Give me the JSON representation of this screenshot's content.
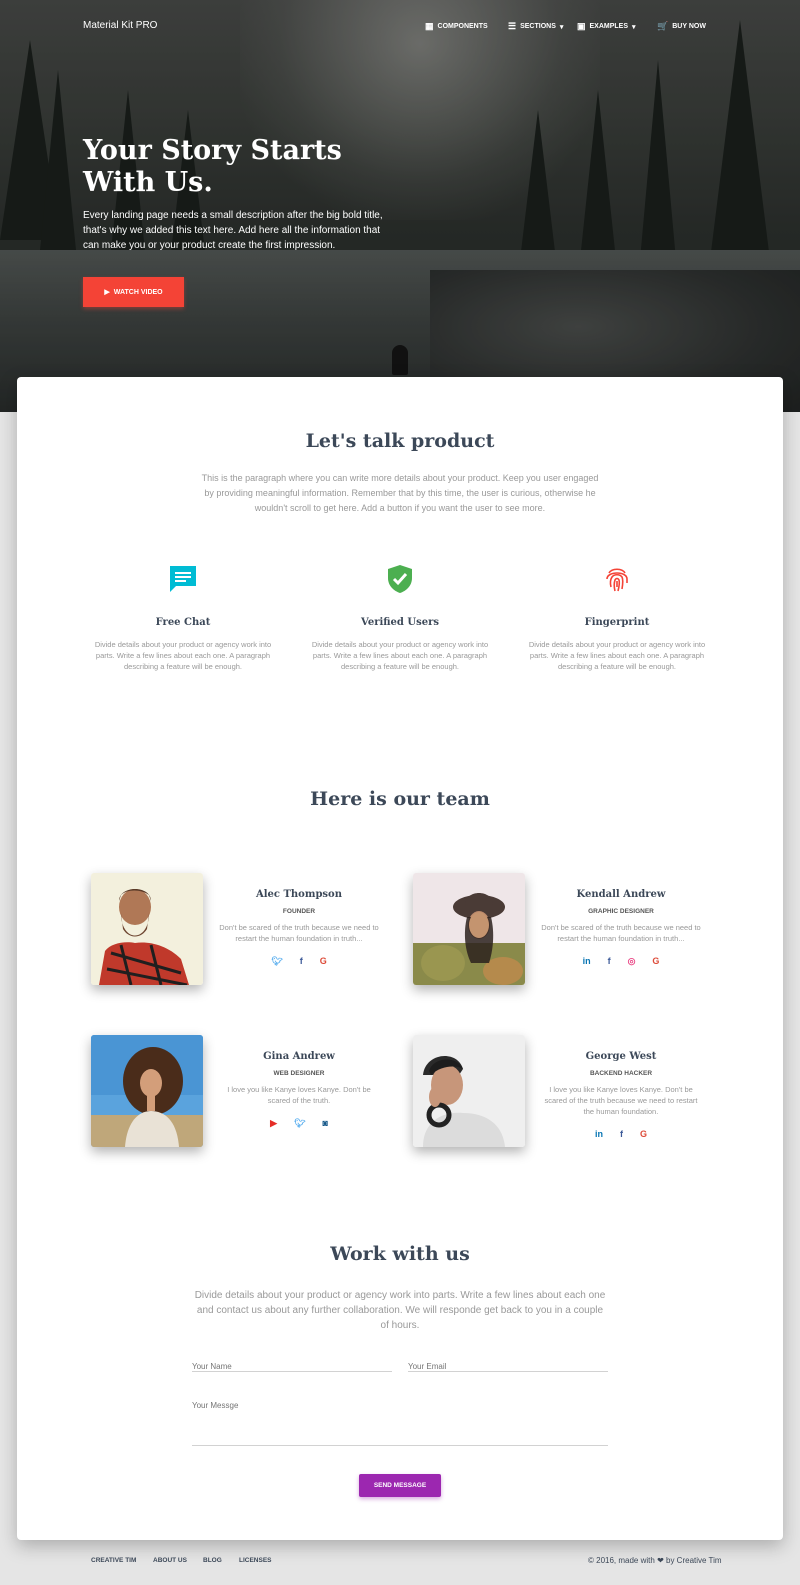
{
  "nav": {
    "brand": "Material Kit PRO",
    "items": [
      {
        "label": "Components",
        "icon": "grid-icon"
      },
      {
        "label": "Sections",
        "icon": "view-day-icon"
      },
      {
        "label": "Examples",
        "icon": "camera-icon"
      },
      {
        "label": "Buy Now",
        "icon": "cart-icon"
      }
    ]
  },
  "hero": {
    "title": "Your Story Starts With Us.",
    "description": "Every landing page needs a small description after the big bold title, that's why we added this text here. Add here all the information that can make you or your product create the first impression.",
    "button": "Watch video"
  },
  "product": {
    "title": "Let's talk product",
    "description": "This is the paragraph where you can write more details about your product. Keep you user engaged by providing meaningful information. Remember that by this time, the user is curious, otherwise he wouldn't scroll to get here. Add a button if you want the user to see more.",
    "features": [
      {
        "title": "Free Chat",
        "icon": "chat-icon",
        "color": "#00bcd4",
        "text": "Divide details about your product or agency work into parts. Write a few lines about each one. A paragraph describing a feature will be enough."
      },
      {
        "title": "Verified Users",
        "icon": "verified-shield-icon",
        "color": "#4caf50",
        "text": "Divide details about your product or agency work into parts. Write a few lines about each one. A paragraph describing a feature will be enough."
      },
      {
        "title": "Fingerprint",
        "icon": "fingerprint-icon",
        "color": "#f44336",
        "text": "Divide details about your product or agency work into parts. Write a few lines about each one. A paragraph describing a feature will be enough."
      }
    ]
  },
  "team": {
    "title": "Here is our team",
    "members": [
      {
        "name": "Alec Thompson",
        "role": "Founder",
        "bio": "Don't be scared of the truth because we need to restart the human foundation in truth...",
        "socials": [
          "twitter",
          "facebook",
          "google"
        ]
      },
      {
        "name": "Kendall Andrew",
        "role": "Graphic Designer",
        "bio": "Don't be scared of the truth because we need to restart the human foundation in truth...",
        "socials": [
          "linkedin",
          "facebook",
          "dribbble",
          "google"
        ]
      },
      {
        "name": "Gina Andrew",
        "role": "Web Designer",
        "bio": "I love you like Kanye loves Kanye. Don't be scared of the truth.",
        "socials": [
          "youtube",
          "twitter",
          "instagram"
        ]
      },
      {
        "name": "George West",
        "role": "Backend Hacker",
        "bio": "I love you like Kanye loves Kanye. Don't be scared of the truth because we need to restart the human foundation.",
        "socials": [
          "linkedin",
          "facebook",
          "google"
        ]
      }
    ]
  },
  "contact": {
    "title": "Work with us",
    "description": "Divide details about your product or agency work into parts. Write a few lines about each one and contact us about any further collaboration. We will responde get back to you in a couple of hours.",
    "name_placeholder": "Your Name",
    "email_placeholder": "Your Email",
    "message_placeholder": "Your Messge",
    "button": "Send Message"
  },
  "footer": {
    "links": [
      "Creative Tim",
      "About Us",
      "Blog",
      "Licenses"
    ],
    "copyright_prefix": "© 2016, made with",
    "copyright_suffix": "by Creative Tim"
  },
  "colors": {
    "accent_red": "#f44336",
    "accent_purple": "#9c27b0",
    "info": "#00bcd4",
    "success": "#4caf50"
  }
}
